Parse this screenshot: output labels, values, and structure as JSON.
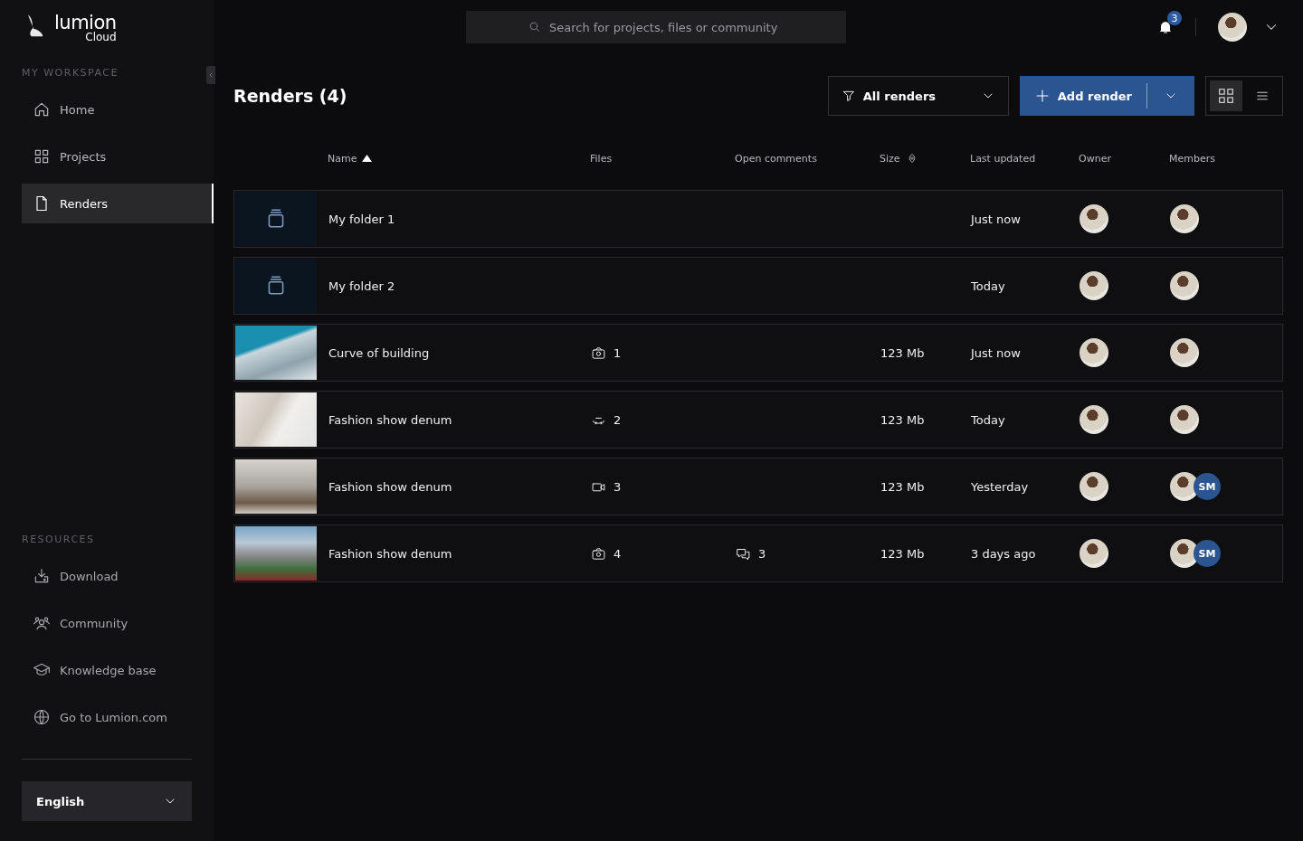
{
  "logo": {
    "word": "lumion",
    "sub": "Cloud"
  },
  "search": {
    "placeholder": "Search for projects, files or community"
  },
  "notifications": {
    "count": "3"
  },
  "sidebar": {
    "workspace_heading": "MY WORKSPACE",
    "items": [
      {
        "label": "Home",
        "selected": false
      },
      {
        "label": "Projects",
        "selected": false
      },
      {
        "label": "Renders",
        "selected": true
      }
    ],
    "resources_heading": "RESOURCES",
    "resources": [
      {
        "label": "Download"
      },
      {
        "label": "Community"
      },
      {
        "label": "Knowledge base"
      },
      {
        "label": "Go to Lumion.com"
      }
    ],
    "language": "English"
  },
  "page_title": "Renders (4)",
  "filter": {
    "label": "All renders"
  },
  "add_button": {
    "label": "Add render"
  },
  "view_toggle": [
    {
      "selected": true
    },
    {
      "selected": false
    }
  ],
  "table": {
    "columns": [
      {
        "label": "Name",
        "kind": "ascending"
      },
      {
        "label": "Files",
        "kind": "plain"
      },
      {
        "label": "Open comments",
        "kind": "plain"
      },
      {
        "label": "Size",
        "kind": "sortable"
      },
      {
        "label": "Last updated",
        "kind": "plain"
      },
      {
        "label": "Owner",
        "kind": "plain"
      },
      {
        "label": "Members",
        "kind": "plain"
      }
    ],
    "rows": [
      {
        "kind": "folder",
        "name": "My folder 1",
        "updated": "Just now"
      },
      {
        "kind": "folder",
        "name": "My folder 2",
        "updated": "Today"
      },
      {
        "kind": "render",
        "name": "Curve of building",
        "files": {
          "kind": "photo",
          "count": "1"
        },
        "size": "123 Mb",
        "updated": "Just now"
      },
      {
        "kind": "render",
        "name": "Fashion show denum",
        "files": {
          "kind": "panorama",
          "count": "2"
        },
        "size": "123 Mb",
        "updated": "Today"
      },
      {
        "kind": "render",
        "name": "Fashion show denum",
        "files": {
          "kind": "video",
          "count": "3"
        },
        "size": "123 Mb",
        "updated": "Yesterday",
        "members_extra": "SM"
      },
      {
        "kind": "render",
        "name": "Fashion show denum",
        "files": {
          "kind": "photo",
          "count": "4"
        },
        "comments": "3",
        "size": "123 Mb",
        "updated": "3 days ago",
        "members_extra": "SM"
      }
    ]
  }
}
